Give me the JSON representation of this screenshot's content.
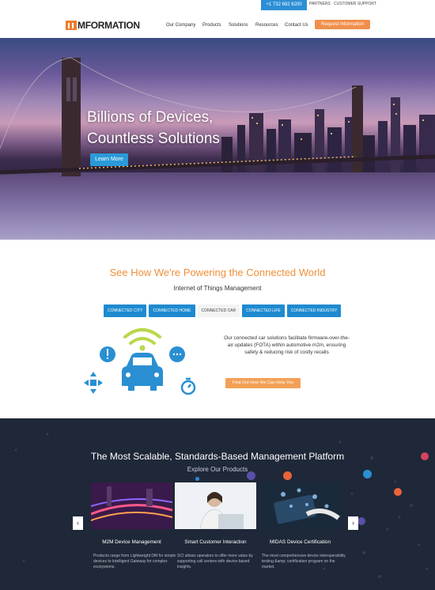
{
  "topbar": {
    "phone": "+1 732 692 6200",
    "partners": "PARTNERS",
    "support": "CUSTOMER SUPPORT"
  },
  "header": {
    "logo_text": "MFORMATION",
    "nav": [
      "Our Company",
      "Products",
      "Solutions",
      "Resources",
      "Contact Us"
    ],
    "request_button": "Request Information"
  },
  "hero": {
    "title_line1": "Billions of Devices,",
    "title_line2": "Countless Solutions",
    "learn_more": "Learn More"
  },
  "iot": {
    "heading": "See How We're Powering the Connected World",
    "subheading": "Internet of Things Management",
    "tabs": [
      "CONNECTED CITY",
      "CONNECTED HOME",
      "CONNECTED CAR",
      "CONNECTED LIFE",
      "CONNECTED INDUSTRY"
    ],
    "active_tab": "CONNECTED CAR",
    "description": "Our connected car solutions facilitate firmware-over-the-air updates (FOTA) within automotive m2m, ensuring safety & reducing risk of costly recalls",
    "cta": "Find Out How We Can Help You"
  },
  "platform": {
    "heading": "The Most Scalable, Standards-Based Management Platform",
    "subheading": "Explore Our Products",
    "cards": [
      {
        "title": "M2M Device Management",
        "text": "Products range from Lightweight DM for simple devices to Intelligent Gateway for complex ecosystems."
      },
      {
        "title": "Smart Customer Interaction",
        "text": "SCI allows operators to offer more value by supporting call centers with device-based insights."
      },
      {
        "title": "MIDAS Device Certification",
        "text": "The most comprehensive device interoperability testing &amp; certification program on the market."
      }
    ],
    "prev_icon": "chevron-left-icon",
    "next_icon": "chevron-right-icon"
  },
  "colors": {
    "accent_orange": "#f08f3a",
    "accent_blue": "#1e8ad0",
    "dark_bg": "#1f2838"
  }
}
